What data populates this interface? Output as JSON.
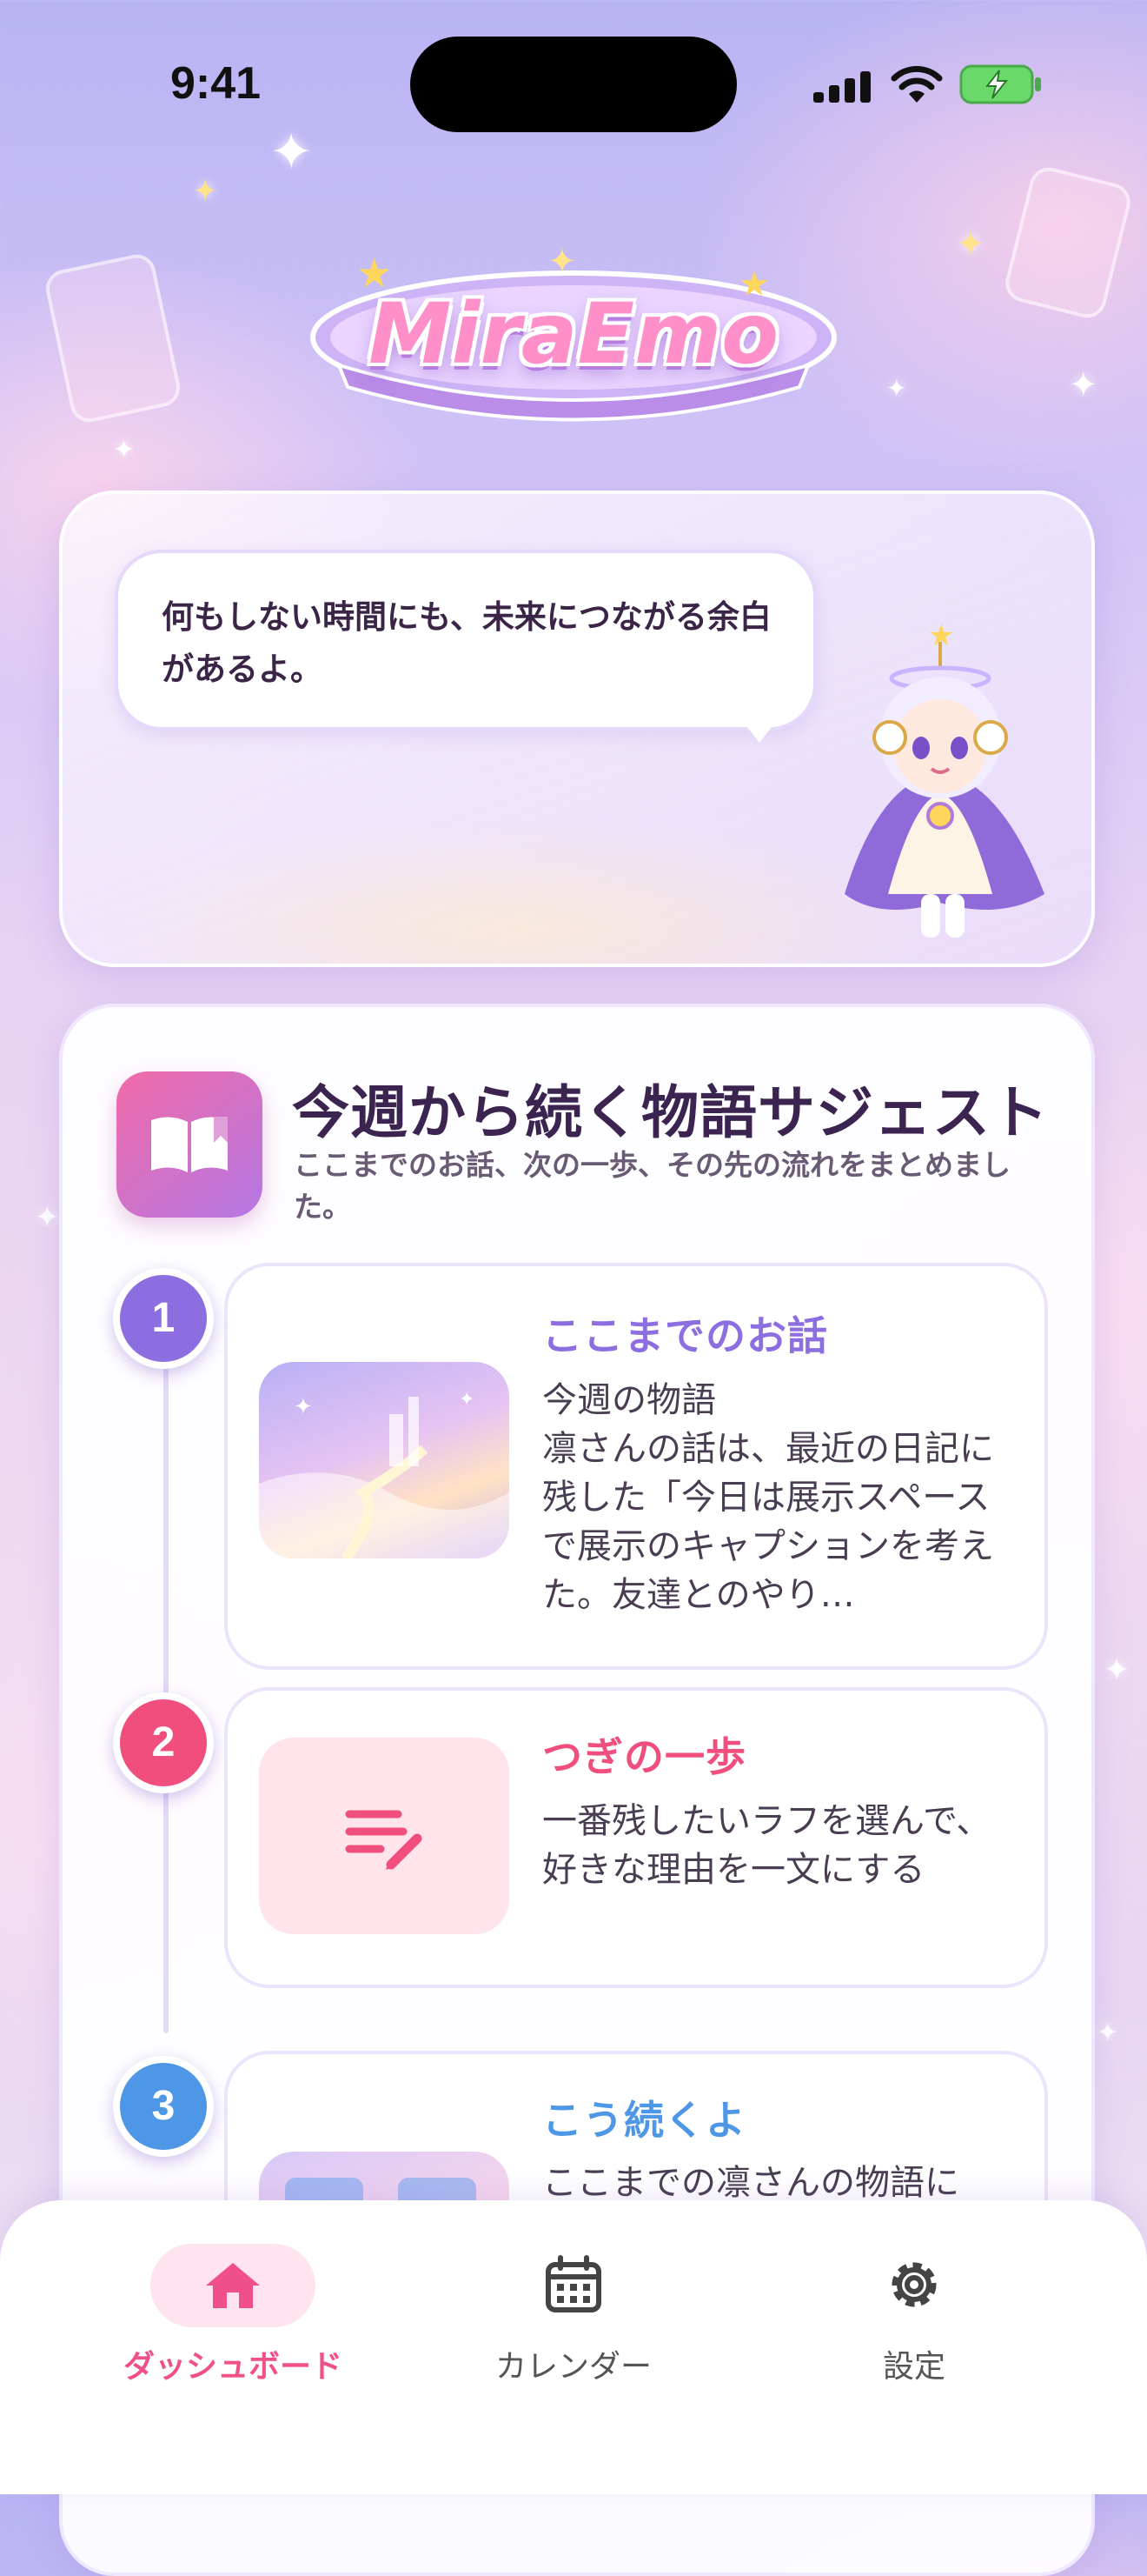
{
  "status": {
    "time": "9:41"
  },
  "app": {
    "logo_text": "MiraEmo"
  },
  "message": {
    "text": "何もしない時間にも、未来につながる余白があるよ。"
  },
  "suggest": {
    "title": "今週から続く物語サジェスト",
    "subtitle": "ここまでのお話、次の一歩、その先の流れをまとめました。",
    "steps": [
      {
        "number": "1",
        "heading": "ここまでのお話",
        "body": "今週の物語\n凛さんの話は、最近の日記に残した「今日は展示スペースで展示のキャプションを考えた。友達とのやり…"
      },
      {
        "number": "2",
        "heading": "つぎの一歩",
        "body": "一番残したいラフを選んで、好きな理由を一文にする"
      },
      {
        "number": "3",
        "heading": "こう続くよ",
        "body": "ここまでの凛さんの物語に"
      }
    ]
  },
  "nav": {
    "items": [
      {
        "label": "ダッシュボード",
        "icon": "home-icon",
        "active": true
      },
      {
        "label": "カレンダー",
        "icon": "calendar-icon",
        "active": false
      },
      {
        "label": "設定",
        "icon": "gear-icon",
        "active": false
      }
    ]
  },
  "colors": {
    "accent_pink": "#f0508a",
    "step1": "#8d6ee0",
    "step2": "#f04f7e",
    "step3": "#4d97e6",
    "title": "#3b2450"
  }
}
